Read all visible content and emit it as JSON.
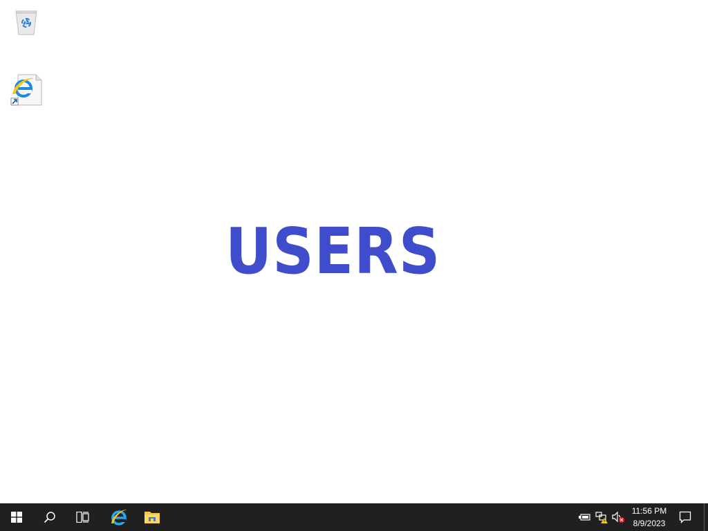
{
  "desktop": {
    "wallpaper_text": "USERS",
    "wallpaper_text_color": "#3f4ccc",
    "icons": [
      {
        "name": "recycle-bin-icon"
      },
      {
        "name": "internet-explorer-shortcut-icon"
      }
    ]
  },
  "taskbar": {
    "background": "#202020",
    "pinned": [
      "start-icon",
      "search-icon",
      "task-view-icon",
      "internet-explorer-icon",
      "file-explorer-icon"
    ],
    "tray": [
      "power-icon",
      "network-warning-icon",
      "volume-muted-icon"
    ],
    "clock": {
      "time": "11:56 PM",
      "date": "8/9/2023"
    },
    "notifications_icon": "action-center-icon"
  }
}
